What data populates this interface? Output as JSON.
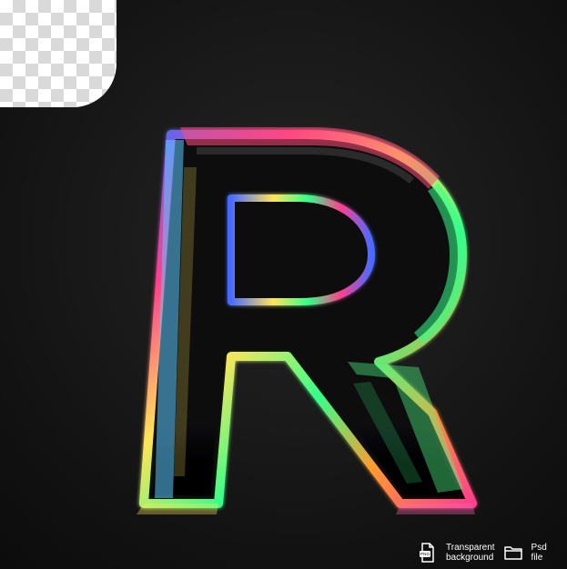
{
  "scene": {
    "subject_icon": "letter-r-3d-iridescent-icon",
    "background_color": "#1b1b1b",
    "checker_colors": [
      "#ffffff",
      "#d9d9d9"
    ]
  },
  "badges": [
    {
      "icon": "png-file-icon",
      "line1": "Transparent",
      "line2": "background"
    },
    {
      "icon": "folder-file-icon",
      "line1": "Psd",
      "line2": "file"
    }
  ],
  "colors": {
    "accent_blue": "#4a6bff",
    "accent_green": "#35ff8a",
    "accent_pink": "#ff3f8e",
    "accent_yellow": "#ffe45a",
    "accent_orange": "#ff9b2f"
  }
}
